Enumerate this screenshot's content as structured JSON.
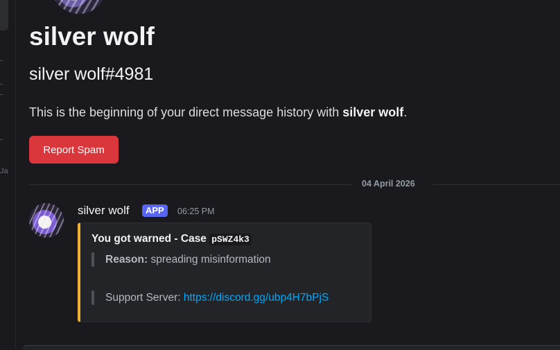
{
  "sidebar_strip": {
    "text": "Ja"
  },
  "profile": {
    "display_name": "silver wolf",
    "username_tag": "silver wolf#4981",
    "intro_prefix": "This is the beginning of your direct message history with ",
    "intro_name": "silver wolf",
    "intro_suffix": ".",
    "report_button": "Report Spam"
  },
  "divider": {
    "date": "04 April 2026"
  },
  "message": {
    "author": "silver wolf",
    "badge": "APP",
    "time": "06:25 PM",
    "embed": {
      "accent_color": "#f0b232",
      "title_prefix": "You got warned - Case ",
      "case_id": "pSWZ4k3",
      "reason_label": "Reason:",
      "reason_value": " spreading misinformation",
      "support_label": "Support Server: ",
      "support_link": "https://discord.gg/ubp4H7bPjS"
    }
  },
  "colors": {
    "background": "#1a1a1e",
    "report_button": "#da373c",
    "app_badge": "#5865f2",
    "link": "#00a8fc"
  }
}
